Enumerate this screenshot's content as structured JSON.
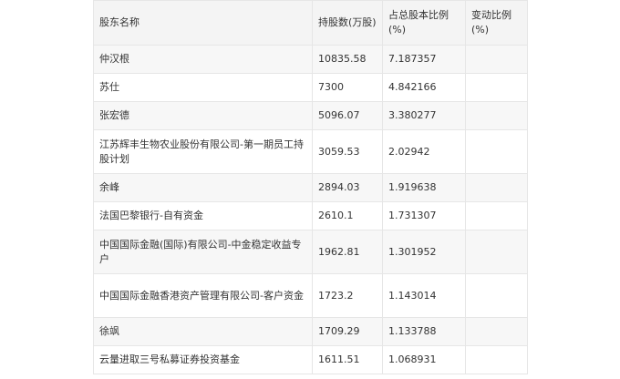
{
  "table": {
    "headers": [
      "股东名称",
      "持股数(万股)",
      "占总股本比例(%)",
      "变动比例(%)"
    ],
    "rows": [
      {
        "name": "仲汉根",
        "shares": "10835.58",
        "ratio": "7.187357",
        "change": ""
      },
      {
        "name": "苏仕",
        "shares": "7300",
        "ratio": "4.842166",
        "change": ""
      },
      {
        "name": "张宏德",
        "shares": "5096.07",
        "ratio": "3.380277",
        "change": ""
      },
      {
        "name": "江苏辉丰生物农业股份有限公司-第一期员工持股计划",
        "shares": "3059.53",
        "ratio": "2.02942",
        "change": ""
      },
      {
        "name": "余峰",
        "shares": "2894.03",
        "ratio": "1.919638",
        "change": ""
      },
      {
        "name": "法国巴黎银行-自有资金",
        "shares": "2610.1",
        "ratio": "1.731307",
        "change": ""
      },
      {
        "name": "中国国际金融(国际)有限公司-中金稳定收益专户",
        "shares": "1962.81",
        "ratio": "1.301952",
        "change": ""
      },
      {
        "name": "中国国际金融香港资产管理有限公司-客户资金",
        "shares": "1723.2",
        "ratio": "1.143014",
        "change": ""
      },
      {
        "name": "徐飒",
        "shares": "1709.29",
        "ratio": "1.133788",
        "change": ""
      },
      {
        "name": "云量进取三号私募证券投资基金",
        "shares": "1611.51",
        "ratio": "1.068931",
        "change": ""
      }
    ]
  }
}
